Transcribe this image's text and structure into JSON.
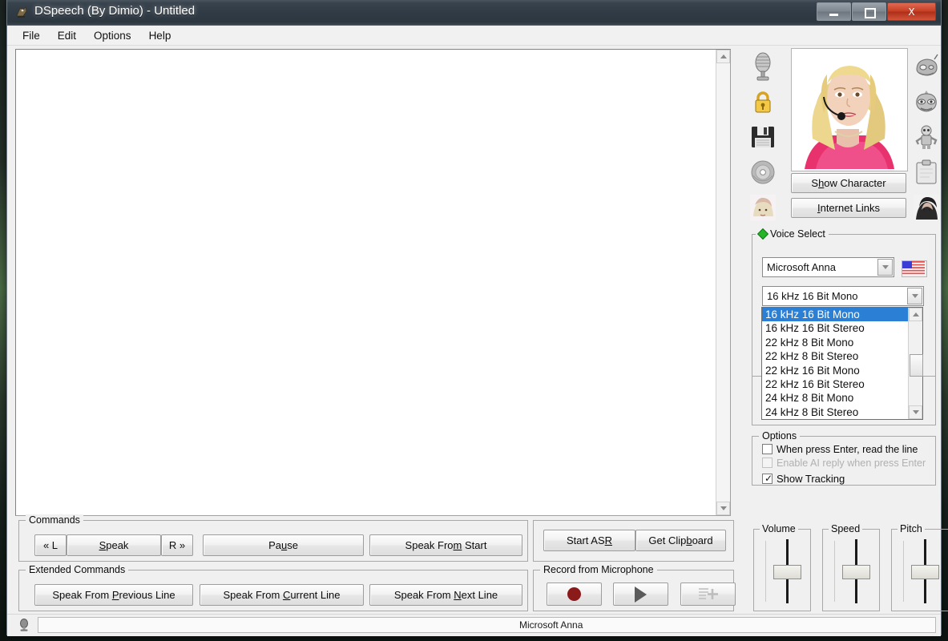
{
  "window": {
    "title": "DSpeech (By Dimio) - Untitled",
    "icon": "app-icon",
    "minimize_label": "Minimize",
    "maximize_label": "Maximize",
    "close_label": "X"
  },
  "menu": {
    "items": [
      {
        "label": "File"
      },
      {
        "label": "Edit"
      },
      {
        "label": "Options"
      },
      {
        "label": "Help"
      }
    ]
  },
  "editor": {
    "text": "",
    "placeholder": ""
  },
  "right_panel": {
    "left_icons": [
      {
        "name": "microphone-icon",
        "glyph": "🎙"
      },
      {
        "name": "padlock-icon",
        "glyph": "🔒"
      },
      {
        "name": "floppy-disk-icon",
        "glyph": "💾"
      },
      {
        "name": "cd-disc-icon",
        "glyph": "💿"
      },
      {
        "name": "character-blond-icon",
        "glyph": "👱"
      }
    ],
    "right_icons": [
      {
        "name": "robot-head-icon",
        "glyph": "🤖"
      },
      {
        "name": "alien-mask-icon",
        "glyph": "👾"
      },
      {
        "name": "robot-figure-icon",
        "glyph": "🦾"
      },
      {
        "name": "clipboard-icon",
        "glyph": "📋"
      },
      {
        "name": "character-dark-icon",
        "glyph": "🧑"
      }
    ],
    "character_preview": "character-portrait-anna",
    "show_character_button": "Show Character",
    "internet_links_button": "Internet Links"
  },
  "voice_select": {
    "group_title": "Voice Select",
    "voice_value": "Microsoft Anna",
    "flag": "us-flag-icon",
    "format_value": "16 kHz 16 Bit Mono",
    "format_options": [
      "16 kHz 16 Bit Mono",
      "16 kHz 16 Bit Stereo",
      "22 kHz 8 Bit Mono",
      "22 kHz 8 Bit Stereo",
      "22 kHz 16 Bit Mono",
      "22 kHz 16 Bit Stereo",
      "24 kHz 8 Bit Mono",
      "24 kHz 8 Bit Stereo"
    ],
    "selected_index": 0,
    "hidden_group_title": "F"
  },
  "options": {
    "group_title": "Options",
    "items": [
      {
        "label": "When press Enter, read the line",
        "checked": false,
        "disabled": false
      },
      {
        "label": "Enable AI reply when press Enter",
        "checked": false,
        "disabled": true
      },
      {
        "label": "Show Tracking",
        "checked": true,
        "disabled": false
      }
    ]
  },
  "commands": {
    "group_title": "Commands",
    "prev_label": "« L",
    "speak_label": "Speak",
    "next_label": "R »",
    "pause_label": "Pause",
    "speak_from_start_label": "Speak From Start"
  },
  "extended_commands": {
    "group_title": "Extended Commands",
    "previous_line_label": "Speak From Previous Line",
    "current_line_label": "Speak From Current Line",
    "next_line_label": "Speak From Next Line"
  },
  "asr": {
    "start_asr_label": "Start ASR",
    "get_clipboard_label": "Get Clipboard"
  },
  "record": {
    "group_title": "Record from Microphone",
    "record_button": "record-circle-icon",
    "play_button": "play-triangle-icon",
    "add_button": "add-plus-icon"
  },
  "sliders": [
    {
      "name": "Volume",
      "value": 50
    },
    {
      "name": "Speed",
      "value": 50
    },
    {
      "name": "Pitch",
      "value": 50
    }
  ],
  "status_bar": {
    "icon": "microphone-small-icon",
    "text": "Microsoft Anna"
  },
  "colors": {
    "titlebar": "#303b46",
    "close_button": "#c73e24",
    "selection": "#2b7fd4",
    "face": "#f0f0f0",
    "record_red": "#8b1a1a"
  }
}
